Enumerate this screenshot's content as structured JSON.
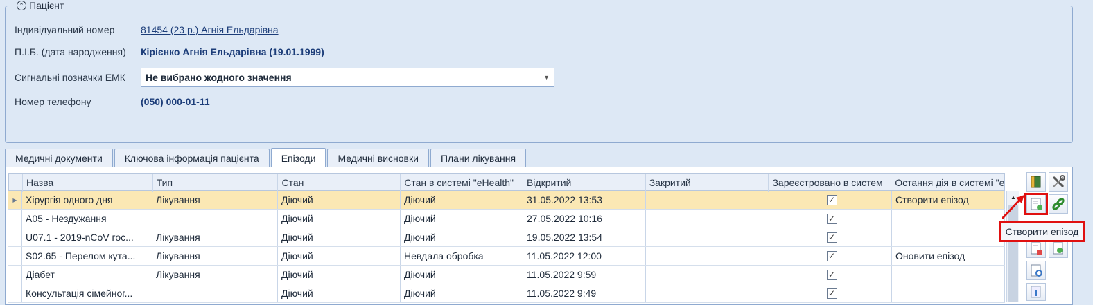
{
  "patient": {
    "group_title": "Пацієнт",
    "fields": {
      "id_label": "Індивідуальний номер",
      "id_value": "81454 (23 р.) Агнія Ельдарівна",
      "name_label": "П.І.Б. (дата народження)",
      "name_value": "Кірієнко Агнія Ельдарівна (19.01.1999)",
      "signal_label": "Сигнальні позначки ЕМК",
      "signal_value": "Не вибрано жодного значення",
      "phone_label": "Номер телефону",
      "phone_value": "(050) 000-01-11"
    }
  },
  "tabs": [
    {
      "label": "Медичні документи",
      "active": false
    },
    {
      "label": "Ключова інформація пацієнта",
      "active": false
    },
    {
      "label": "Епізоди",
      "active": true
    },
    {
      "label": "Медичні висновки",
      "active": false
    },
    {
      "label": "Плани лікування",
      "active": false
    }
  ],
  "grid": {
    "columns": [
      "Назва",
      "Тип",
      "Стан",
      "Стан в системі \"eHealth\"",
      "Відкритий",
      "Закритий",
      "Зареєстровано в систем",
      "Остання дія в системі \"e"
    ],
    "rows": [
      {
        "name": "Хірургія одного дня",
        "type": "Лікування",
        "state": "Діючий",
        "ehealth_state": "Діючий",
        "opened": "31.05.2022 13:53",
        "closed": "",
        "registered": true,
        "last_action": "Створити епізод",
        "selected": true
      },
      {
        "name": "A05 - Нездужання",
        "type": "",
        "state": "Діючий",
        "ehealth_state": "Діючий",
        "opened": "27.05.2022 10:16",
        "closed": "",
        "registered": true,
        "last_action": "",
        "selected": false
      },
      {
        "name": "U07.1 - 2019-nCoV гос...",
        "type": "Лікування",
        "state": "Діючий",
        "ehealth_state": "Діючий",
        "opened": "19.05.2022 13:54",
        "closed": "",
        "registered": true,
        "last_action": "",
        "selected": false
      },
      {
        "name": "S02.65 - Перелом кута...",
        "type": "Лікування",
        "state": "Діючий",
        "ehealth_state": "Невдала обробка",
        "opened": "11.05.2022 12:00",
        "closed": "",
        "registered": true,
        "last_action": "Оновити епізод",
        "selected": false
      },
      {
        "name": "Діабет",
        "type": "Лікування",
        "state": "Діючий",
        "ehealth_state": "Діючий",
        "opened": "11.05.2022 9:59",
        "closed": "",
        "registered": true,
        "last_action": "",
        "selected": false
      },
      {
        "name": "Консультація сімейног...",
        "type": "",
        "state": "Діючий",
        "ehealth_state": "Діючий",
        "opened": "11.05.2022 9:49",
        "closed": "",
        "registered": true,
        "last_action": "",
        "selected": false
      }
    ]
  },
  "toolbar": {
    "buttons": [
      "book-icon",
      "tools-icon",
      "create-episode-icon",
      "link-icon",
      "document-delete-icon",
      "document-link-icon",
      "document-refresh-icon",
      "document-down-icon"
    ],
    "tooltip": "Створити епізод"
  },
  "colors": {
    "background": "#dde8f5",
    "selected_row": "#fbe8b4",
    "highlight": "#e01010",
    "link": "#1c3d79"
  }
}
